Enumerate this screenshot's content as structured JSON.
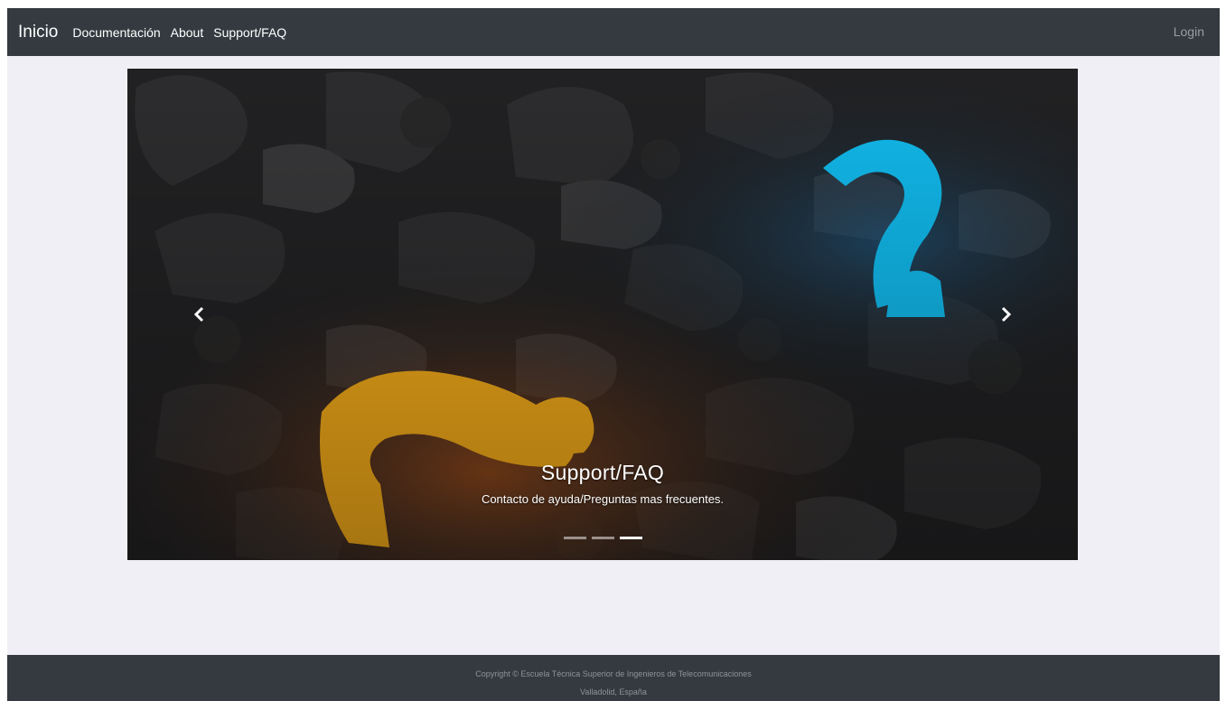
{
  "navbar": {
    "brand": "Inicio",
    "links": [
      "Documentación",
      "About",
      "Support/FAQ"
    ],
    "login": "Login"
  },
  "carousel": {
    "title": "Support/FAQ",
    "caption": "Contacto de ayuda/Preguntas mas frecuentes.",
    "slide_count": 3,
    "active_slide": 3
  },
  "footer": {
    "line1": "Copyright © Escuela Técnica Superior de Ingenieros de Telecomunicaciones",
    "line2": "Valladolid, España"
  },
  "colors": {
    "navbar_bg": "#343a40",
    "page_bg": "#f0eff5",
    "accent_orange": "#ffb31a",
    "accent_blue": "#12c2f7"
  }
}
